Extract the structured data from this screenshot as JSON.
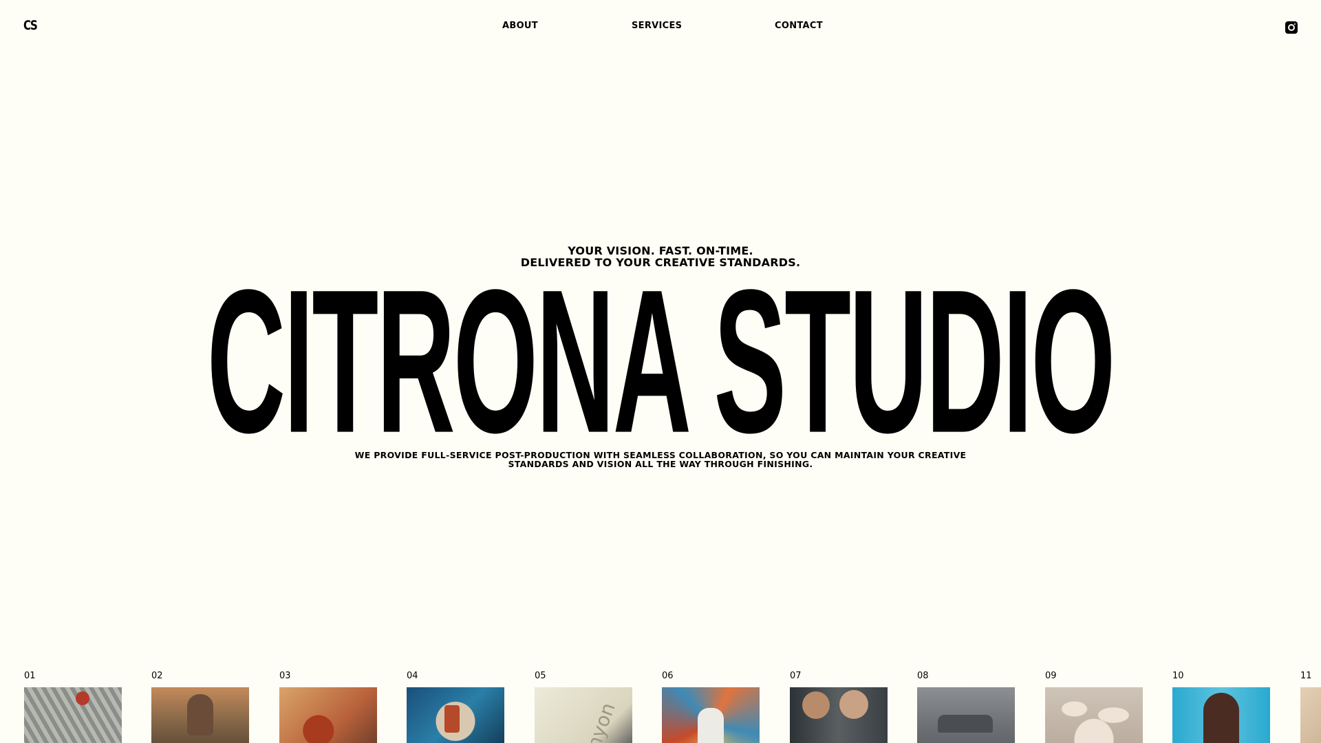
{
  "header": {
    "logo": "CS",
    "nav": [
      {
        "label": "ABOUT"
      },
      {
        "label": "SERVICES"
      },
      {
        "label": "CONTACT"
      }
    ],
    "social_icon": "instagram-icon"
  },
  "hero": {
    "tagline_line1": "YOUR VISION. FAST. ON-TIME.",
    "tagline_line2": "DELIVERED TO YOUR CREATIVE STANDARDS.",
    "title": "CITRONA STUDIO",
    "description_line1": "WE PROVIDE FULL-SERVICE POST-PRODUCTION WITH SEAMLESS COLLABORATION, SO YOU CAN MAINTAIN YOUR CREATIVE",
    "description_line2": "STANDARDS AND VISION ALL THE WAY THROUGH FINISHING."
  },
  "projects": [
    {
      "number": "01"
    },
    {
      "number": "02"
    },
    {
      "number": "03"
    },
    {
      "number": "04"
    },
    {
      "number": "05"
    },
    {
      "number": "06"
    },
    {
      "number": "07"
    },
    {
      "number": "08"
    },
    {
      "number": "09"
    },
    {
      "number": "10"
    },
    {
      "number": "11"
    }
  ],
  "colors": {
    "background": "#fffef6",
    "text": "#000000"
  }
}
